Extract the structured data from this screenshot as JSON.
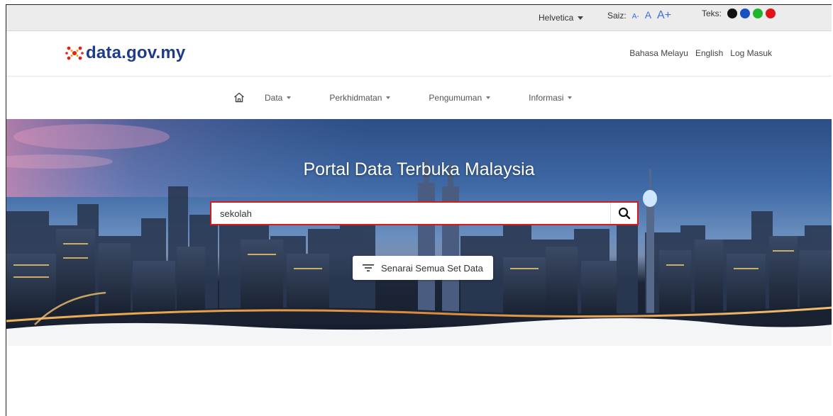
{
  "utility_bar": {
    "font_select": "Helvetica",
    "size_label": "Saiz:",
    "size_small": "A-",
    "size_normal": "A",
    "size_large": "A+",
    "text_label": "Teks:",
    "text_colors": [
      "#111111",
      "#1a4fbf",
      "#1eb52a",
      "#e0151b"
    ]
  },
  "header": {
    "logo_text": "data.gov.my",
    "links": [
      "Bahasa Melayu",
      "English",
      "Log Masuk"
    ]
  },
  "nav": {
    "items": [
      "Data",
      "Perkhidmatan",
      "Pengumuman",
      "Informasi"
    ]
  },
  "hero": {
    "title": "Portal Data Terbuka Malaysia",
    "search": {
      "value": "sekolah",
      "placeholder": ""
    },
    "list_button": "Senarai Semua Set Data"
  },
  "colors": {
    "brand": "#1f3c8a",
    "accent": "#3d6fd9",
    "search_border": "#d71a1a"
  }
}
